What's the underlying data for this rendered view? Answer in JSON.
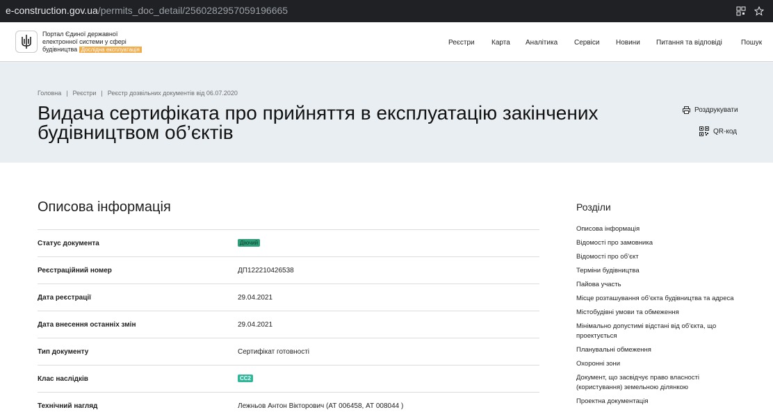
{
  "browser": {
    "url_host": "e-construction.gov.ua",
    "url_path": "/permits_doc_detail/2560282957059196665"
  },
  "header": {
    "logo_text": "Портал Єдиної державної електронної системи у сфері будівництва",
    "beta_badge": "Дослідна експлуатація",
    "nav": [
      "Реєстри",
      "Карта",
      "Аналітика",
      "Сервіси",
      "Новини",
      "Питання та відповіді",
      "Пошук"
    ]
  },
  "breadcrumb": [
    "Головна",
    "Реєстри",
    "Реєстр дозвільних документів від 06.07.2020"
  ],
  "page": {
    "title": "Видача сертифіката про прийняття в експлуатацію закінчених будівництвом об’єктів",
    "print_label": "Роздрукувати",
    "qr_label": "QR-код"
  },
  "section": {
    "title": "Описова інформація",
    "rows": [
      {
        "label": "Статус документа",
        "value": "Діючий"
      },
      {
        "label": "Реєстраційний номер",
        "value": "ДП122210426538"
      },
      {
        "label": "Дата реєстрації",
        "value": "29.04.2021"
      },
      {
        "label": "Дата внесення останніх змін",
        "value": "29.04.2021"
      },
      {
        "label": "Тип документу",
        "value": "Сертифікат готовності"
      },
      {
        "label": "Клас наслідків",
        "value": "CC2"
      },
      {
        "label": "Технічний нагляд",
        "value": "Лежньов Антон Вікторович (АТ 006458, АТ 008044 )"
      }
    ]
  },
  "toc": {
    "title": "Розділи",
    "items": [
      "Описова інформація",
      "Відомості про замовника",
      "Відомості про об’єкт",
      "Терміни будівництва",
      "Пайова участь",
      "Місце розташування об’єкта будівництва та адреса",
      "Містобудівні умови та обмеження",
      "Мінімально допустимі відстані від об’єкта, що проектується",
      "Планувальні обмеження",
      "Охоронні зони",
      "Документ, що засвідчує право власності (користування) земельною ділянкою",
      "Проектна документація"
    ]
  },
  "colors": {
    "hero_bg": "#e9eef2",
    "status_green": "#2e9e78",
    "class_teal": "#2eb79a",
    "beta_orange": "#f0ad4e"
  }
}
